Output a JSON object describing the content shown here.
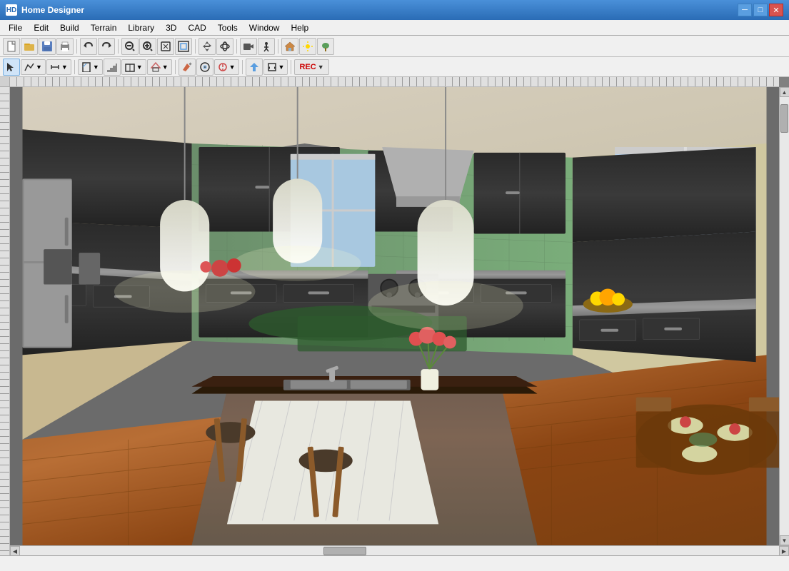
{
  "app": {
    "title": "Home Designer",
    "icon": "HD"
  },
  "title_buttons": {
    "minimize": "─",
    "maximize": "□",
    "close": "✕"
  },
  "menu": {
    "items": [
      "File",
      "Edit",
      "Build",
      "Terrain",
      "Library",
      "3D",
      "CAD",
      "Tools",
      "Window",
      "Help"
    ]
  },
  "toolbar1": {
    "buttons": [
      {
        "name": "new",
        "icon": "□",
        "label": "New"
      },
      {
        "name": "open",
        "icon": "▤",
        "label": "Open"
      },
      {
        "name": "save",
        "icon": "💾",
        "label": "Save"
      },
      {
        "name": "print",
        "icon": "🖨",
        "label": "Print"
      },
      {
        "name": "undo",
        "icon": "↩",
        "label": "Undo"
      },
      {
        "name": "redo",
        "icon": "↪",
        "label": "Redo"
      },
      {
        "name": "zoom-in",
        "icon": "+🔍",
        "label": "Zoom In"
      },
      {
        "name": "zoom-out",
        "icon": "-🔍",
        "label": "Zoom Out"
      },
      {
        "name": "zoom-fit",
        "icon": "⊡",
        "label": "Fit to Window"
      },
      {
        "name": "zoom-window",
        "icon": "⊞",
        "label": "Zoom Window"
      }
    ]
  },
  "toolbar2": {
    "buttons": [
      {
        "name": "select",
        "icon": "↖",
        "label": "Select"
      },
      {
        "name": "line",
        "icon": "╱",
        "label": "Line"
      },
      {
        "name": "wall",
        "icon": "▬",
        "label": "Wall"
      },
      {
        "name": "door",
        "icon": "▭",
        "label": "Door"
      },
      {
        "name": "window",
        "icon": "⊞",
        "label": "Window"
      },
      {
        "name": "roof",
        "icon": "△",
        "label": "Roof"
      },
      {
        "name": "floor",
        "icon": "▦",
        "label": "Floor"
      },
      {
        "name": "camera",
        "icon": "📷",
        "label": "Camera"
      },
      {
        "name": "material",
        "icon": "🎨",
        "label": "Material"
      },
      {
        "name": "arrow-up",
        "icon": "↑",
        "label": "Move Up"
      },
      {
        "name": "transform",
        "icon": "⇄",
        "label": "Transform"
      },
      {
        "name": "rec",
        "icon": "●",
        "label": "Record"
      }
    ]
  },
  "statusbar": {
    "message": ""
  },
  "scene": {
    "title": "Kitchen 3D View",
    "description": "3D perspective view of a modern kitchen with island"
  }
}
